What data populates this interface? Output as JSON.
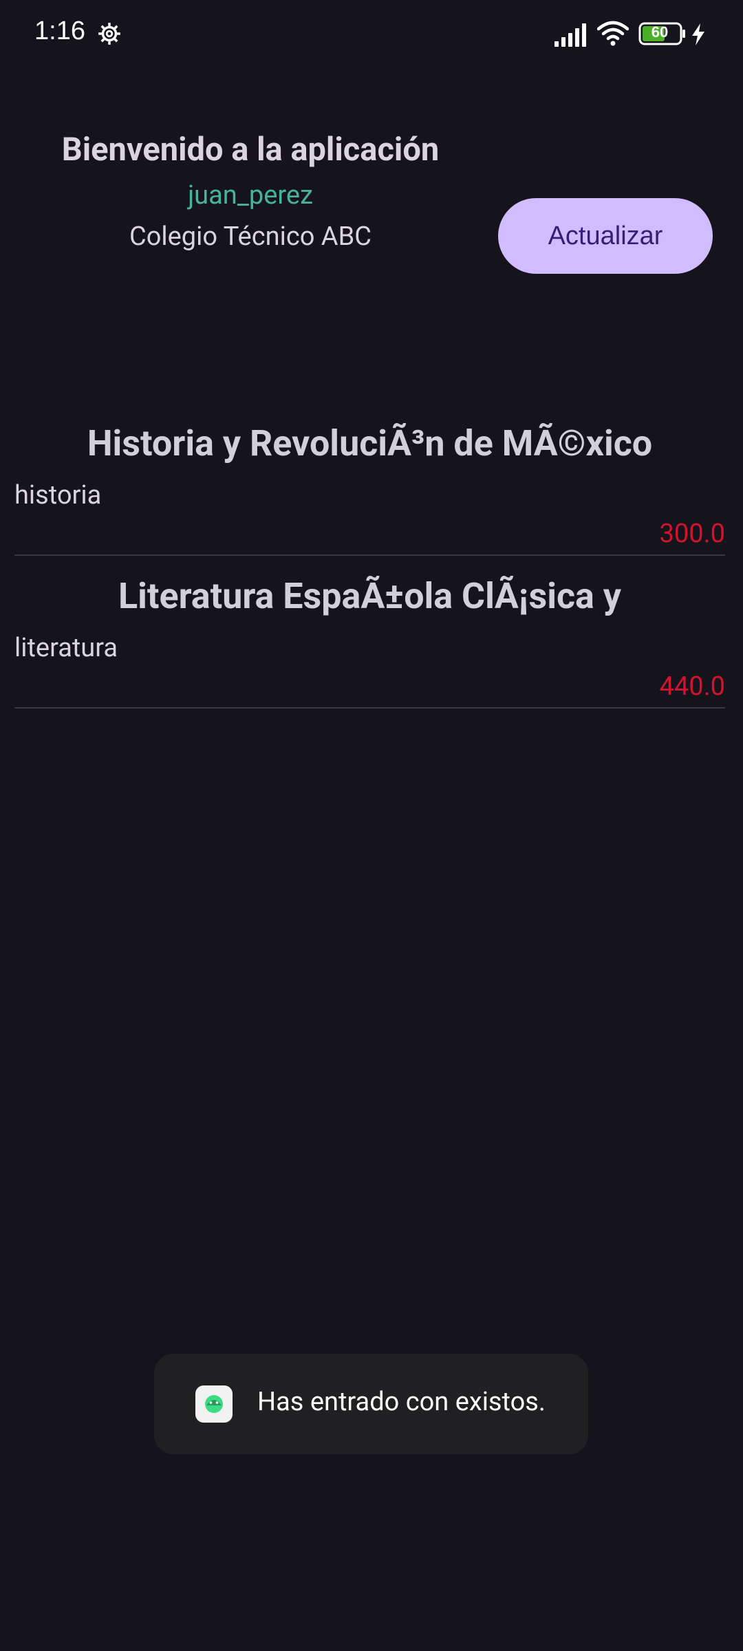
{
  "status_bar": {
    "time": "1:16",
    "battery_level": "60",
    "icons": [
      "gear-icon",
      "signal-icon",
      "wifi-icon",
      "battery-icon",
      "charging-icon"
    ]
  },
  "header": {
    "title": "Bienvenido a la aplicación",
    "username": "juan_perez",
    "school": "Colegio Técnico ABC",
    "refresh_label": "Actualizar"
  },
  "books": [
    {
      "title": "Historia y RevoluciÃ³n de MÃ©xico",
      "category": "historia",
      "price": "300.0"
    },
    {
      "title": "Literatura EspaÃ±ola ClÃ¡sica y",
      "category": "literatura",
      "price": "440.0"
    }
  ],
  "toast": {
    "message": "Has entrado con existos.",
    "icon": "android-app-icon"
  },
  "colors": {
    "background": "#15131b",
    "accent_button": "#d0bcff",
    "username": "#46b39b",
    "price": "#d0142f"
  }
}
